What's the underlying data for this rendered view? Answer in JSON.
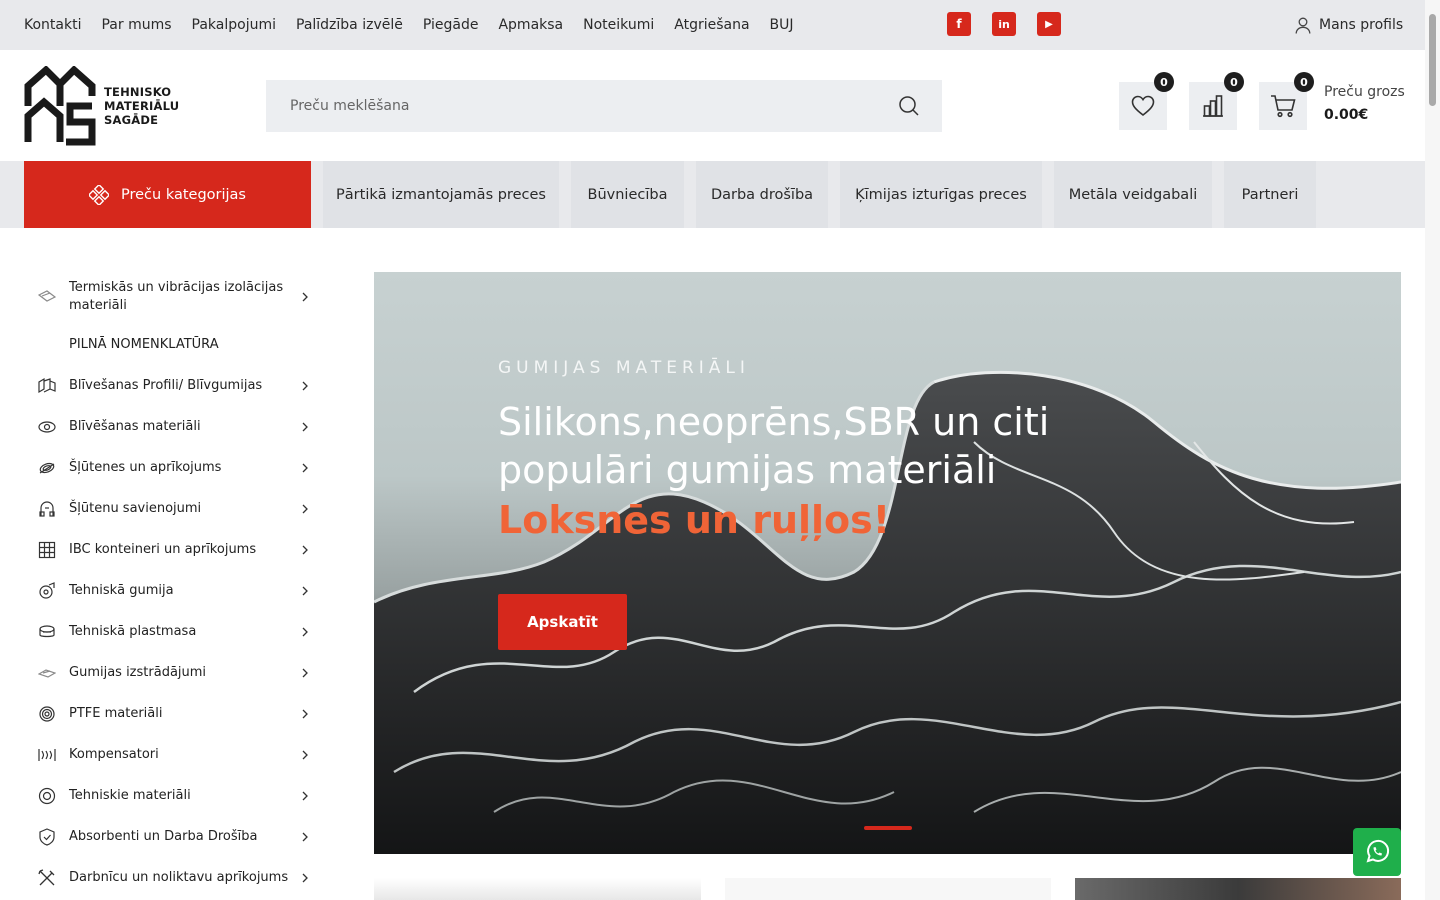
{
  "topnav": [
    "Kontakti",
    "Par mums",
    "Pakalpojumi",
    "Palīdzība izvēlē",
    "Piegāde",
    "Apmaksa",
    "Noteikumi",
    "Atgriešana",
    "BUJ"
  ],
  "social": [
    {
      "name": "facebook-icon",
      "glyph": "f"
    },
    {
      "name": "linkedin-icon",
      "glyph": "in"
    },
    {
      "name": "youtube-icon",
      "glyph": "▶"
    }
  ],
  "profile_label": "Mans profils",
  "logo": {
    "line1": "TEHNISKO",
    "line2": "MATERIĀLU",
    "line3": "SAGĀDE"
  },
  "search": {
    "placeholder": "Preču meklēšana"
  },
  "header": {
    "wishlist_count": "0",
    "compare_count": "0",
    "cart_count": "0",
    "cart_label": "Preču grozs",
    "cart_total": "0.00€"
  },
  "categories_button": "Preču kategorijas",
  "nav_tabs": [
    "Pārtikā izmantojamās preces",
    "Būvniecība",
    "Darba drošība",
    "Ķīmijas izturīgas preces",
    "Metāla veidgabali",
    "Partneri"
  ],
  "sidebar": [
    {
      "label": "Termiskās un vibrācijas izolācijas materiāli",
      "icon": "insulation-icon",
      "arrow": true
    },
    {
      "label": "PILNĀ NOMENKLATŪRA",
      "icon": "",
      "arrow": false
    },
    {
      "label": "Blīvešanas Profili/ Blīvgumijas",
      "icon": "profile-icon",
      "arrow": true
    },
    {
      "label": "Blīvēšanas materiāli",
      "icon": "eye-seal-icon",
      "arrow": true
    },
    {
      "label": "Šļūtenes un aprīkojums",
      "icon": "hose-icon",
      "arrow": true
    },
    {
      "label": "Šļūtenu savienojumi",
      "icon": "coupling-icon",
      "arrow": true
    },
    {
      "label": "IBC konteineri un aprīkojums",
      "icon": "grid-container-icon",
      "arrow": true
    },
    {
      "label": "Tehniskā gumija",
      "icon": "rubber-icon",
      "arrow": true
    },
    {
      "label": "Tehniskā plastmasa",
      "icon": "plastic-icon",
      "arrow": true
    },
    {
      "label": "Gumijas izstrādājumi",
      "icon": "rubber-products-icon",
      "arrow": true
    },
    {
      "label": "PTFE materiāli",
      "icon": "ptfe-icon",
      "arrow": true
    },
    {
      "label": "Kompensatori",
      "icon": "compensator-icon",
      "arrow": true
    },
    {
      "label": "Tehniskie materiāli",
      "icon": "ring-icon",
      "arrow": true
    },
    {
      "label": "Absorbenti un Darba Drošība",
      "icon": "shield-icon",
      "arrow": true
    },
    {
      "label": "Darbnīcu un noliktavu aprīkojums",
      "icon": "tools-icon",
      "arrow": true
    }
  ],
  "hero": {
    "kicker": "GUMIJAS MATERIĀLI",
    "headline": "Silikons,neoprēns,SBR un citi populāri gumijas materiāli",
    "highlight": "Loksnēs un ruļļos!",
    "cta": "Apskatīt"
  },
  "colors": {
    "accent": "#d6281c",
    "highlight": "#f06437",
    "whatsapp": "#1faf4b"
  }
}
